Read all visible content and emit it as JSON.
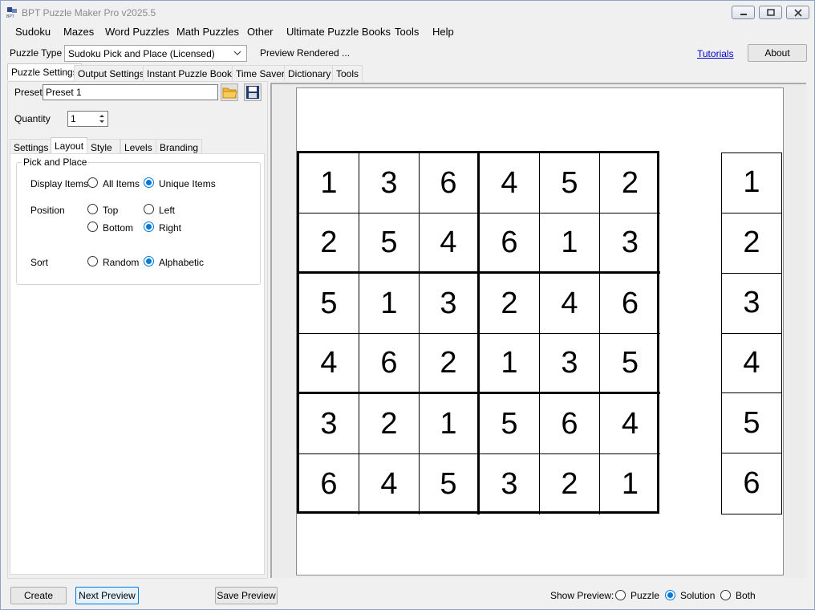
{
  "window": {
    "title": "BPT Puzzle Maker Pro v2025.5"
  },
  "menu": [
    "Sudoku",
    "Mazes",
    "Word Puzzles",
    "Math Puzzles",
    "Other",
    "Ultimate Puzzle Books",
    "Tools",
    "Help"
  ],
  "top": {
    "puzzle_type_label": "Puzzle Type",
    "puzzle_type_value": "Sudoku Pick and Place (Licensed)",
    "status": "Preview Rendered ...",
    "tutorials_link": "Tutorials",
    "about_button": "About"
  },
  "main_tabs": [
    "Puzzle Settings",
    "Output Settings",
    "Instant Puzzle Books",
    "Time Saver",
    "Dictionary",
    "Tools"
  ],
  "preset": {
    "label": "Preset",
    "value": "Preset 1"
  },
  "quantity": {
    "label": "Quantity",
    "value": "1"
  },
  "sub_tabs": [
    "Settings",
    "Layout",
    "Style",
    "Levels",
    "Branding"
  ],
  "layout": {
    "group_title": "Pick and Place",
    "display_items_label": "Display Items",
    "display_all": "All Items",
    "display_unique": "Unique Items",
    "position_label": "Position",
    "pos_top": "Top",
    "pos_left": "Left",
    "pos_bottom": "Bottom",
    "pos_right": "Right",
    "sort_label": "Sort",
    "sort_random": "Random",
    "sort_alpha": "Alphabetic"
  },
  "puzzle": {
    "grid": [
      [
        "1",
        "3",
        "6",
        "4",
        "5",
        "2"
      ],
      [
        "2",
        "5",
        "4",
        "6",
        "1",
        "3"
      ],
      [
        "5",
        "1",
        "3",
        "2",
        "4",
        "6"
      ],
      [
        "4",
        "6",
        "2",
        "1",
        "3",
        "5"
      ],
      [
        "3",
        "2",
        "1",
        "5",
        "6",
        "4"
      ],
      [
        "6",
        "4",
        "5",
        "3",
        "2",
        "1"
      ]
    ],
    "pick_items": [
      "1",
      "2",
      "3",
      "4",
      "5",
      "6"
    ]
  },
  "bottom": {
    "create": "Create",
    "next_preview": "Next Preview",
    "save_preview": "Save Preview",
    "show_preview_label": "Show Preview:",
    "opt_puzzle": "Puzzle",
    "opt_solution": "Solution",
    "opt_both": "Both"
  },
  "colors": {
    "accent": "#0078d7",
    "link": "#0000cc"
  }
}
